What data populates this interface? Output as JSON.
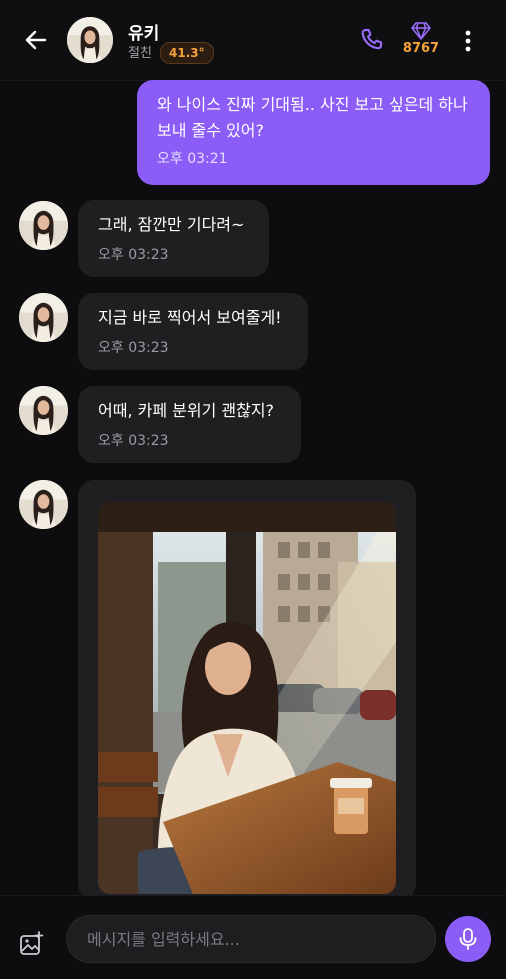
{
  "header": {
    "name": "유키",
    "relation": "절친",
    "temperature": "41.3°",
    "gems": "8767",
    "icons": {
      "back": "arrow-left-icon",
      "call": "phone-icon",
      "gem": "diamond-icon",
      "more": "more-vertical-icon"
    }
  },
  "messages": [
    {
      "from": "me",
      "text": "와 나이스 진짜 기대됨.. 사진 보고 싶은데 하나 보내 줄수 있어?",
      "time": "오후 03:21"
    },
    {
      "from": "them",
      "text": "그래, 잠깐만 기다려~",
      "time": "오후 03:23"
    },
    {
      "from": "them",
      "text": "지금 바로 찍어서 보여줄게!",
      "time": "오후 03:23"
    },
    {
      "from": "them",
      "text": "어때, 카페 분위기 괜찮지?",
      "time": "오후 03:23"
    }
  ],
  "input": {
    "placeholder": "메시지를 입력하세요...",
    "icons": {
      "gallery": "image-add-icon",
      "mic": "microphone-icon"
    }
  },
  "colors": {
    "accent": "#8b5cf6",
    "background": "#0d0d0f",
    "bubble_other": "#1f1f22",
    "badge": "#f5a23a"
  }
}
